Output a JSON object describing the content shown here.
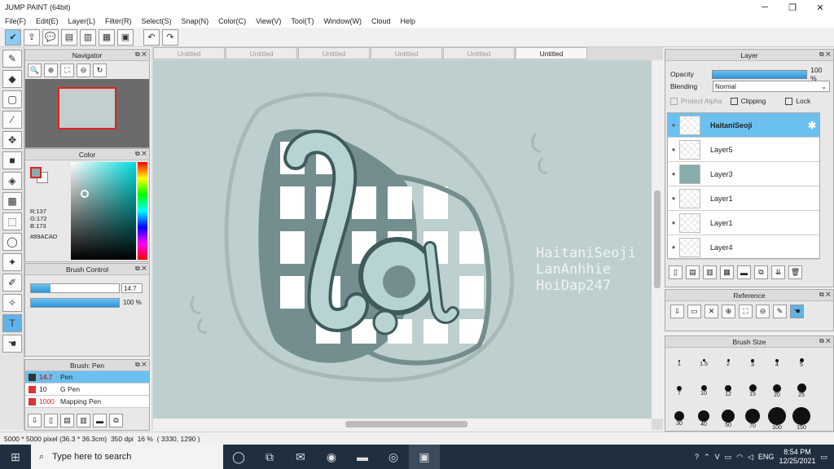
{
  "app": {
    "title": "JUMP PAINT (64bit)"
  },
  "menu": [
    "File(F)",
    "Edit(E)",
    "Layer(L)",
    "Filter(R)",
    "Select(S)",
    "Snap(N)",
    "Color(C)",
    "View(V)",
    "Tool(T)",
    "Window(W)",
    "Cloud",
    "Help"
  ],
  "tabs": [
    "Untitled",
    "Untitled",
    "Untitled",
    "Untitled",
    "Untitled",
    "Untitled"
  ],
  "panels": {
    "navigator": "Navigator",
    "color": {
      "title": "Color",
      "r": "R:137",
      "g": "G:172",
      "b": "B:173",
      "hex": "#89ACAD"
    },
    "brush_control": {
      "title": "Brush Control",
      "size": "14.7",
      "opacity": "100 %",
      "size_fraction": 0.22,
      "opacity_fraction": 1.0
    },
    "brush_list": {
      "title": "Brush: Pen",
      "items": [
        {
          "size": "14.7",
          "name": "Pen"
        },
        {
          "size": "10",
          "name": "G Pen"
        },
        {
          "size": "1000",
          "name": "Mapping Pen"
        }
      ]
    },
    "layer": {
      "title": "Layer",
      "opacity_label": "Opacity",
      "opacity_value": "100 %",
      "blending_label": "Blending",
      "blending_value": "Normal",
      "protect_alpha": "Protect Alpha",
      "clipping": "Clipping",
      "lock": "Lock",
      "layers": [
        "HaitaniSeoji",
        "Layer5",
        "Layer3",
        "Layer1",
        "Layer1",
        "Layer4"
      ]
    },
    "reference": "Reference",
    "brush_size": {
      "title": "Brush Size",
      "rows": [
        [
          "1",
          "1.5",
          "2",
          "3",
          "4",
          "5"
        ],
        [
          "7",
          "10",
          "12",
          "15",
          "20",
          "25"
        ],
        [
          "30",
          "40",
          "50",
          "70",
          "100",
          "150"
        ]
      ]
    }
  },
  "canvas": {
    "watermark": [
      "HaitaniSeoji",
      "LanAnhhie",
      "HoiDap247"
    ],
    "art_text": "la"
  },
  "status": {
    "size": "5000 * 5000 pixel",
    "cm": "(36.3 * 36.3cm)",
    "dpi": "350 dpi",
    "zoom": "16 %",
    "coords": "( 3330, 1290 )"
  },
  "taskbar": {
    "search_placeholder": "Type here to search",
    "lang": "ENG",
    "time": "8:54 PM",
    "date": "12/25/2021"
  },
  "colors": {
    "accent": "#6cc0f0",
    "canvas_bg": "#bdcfce",
    "art": "#89acad"
  }
}
